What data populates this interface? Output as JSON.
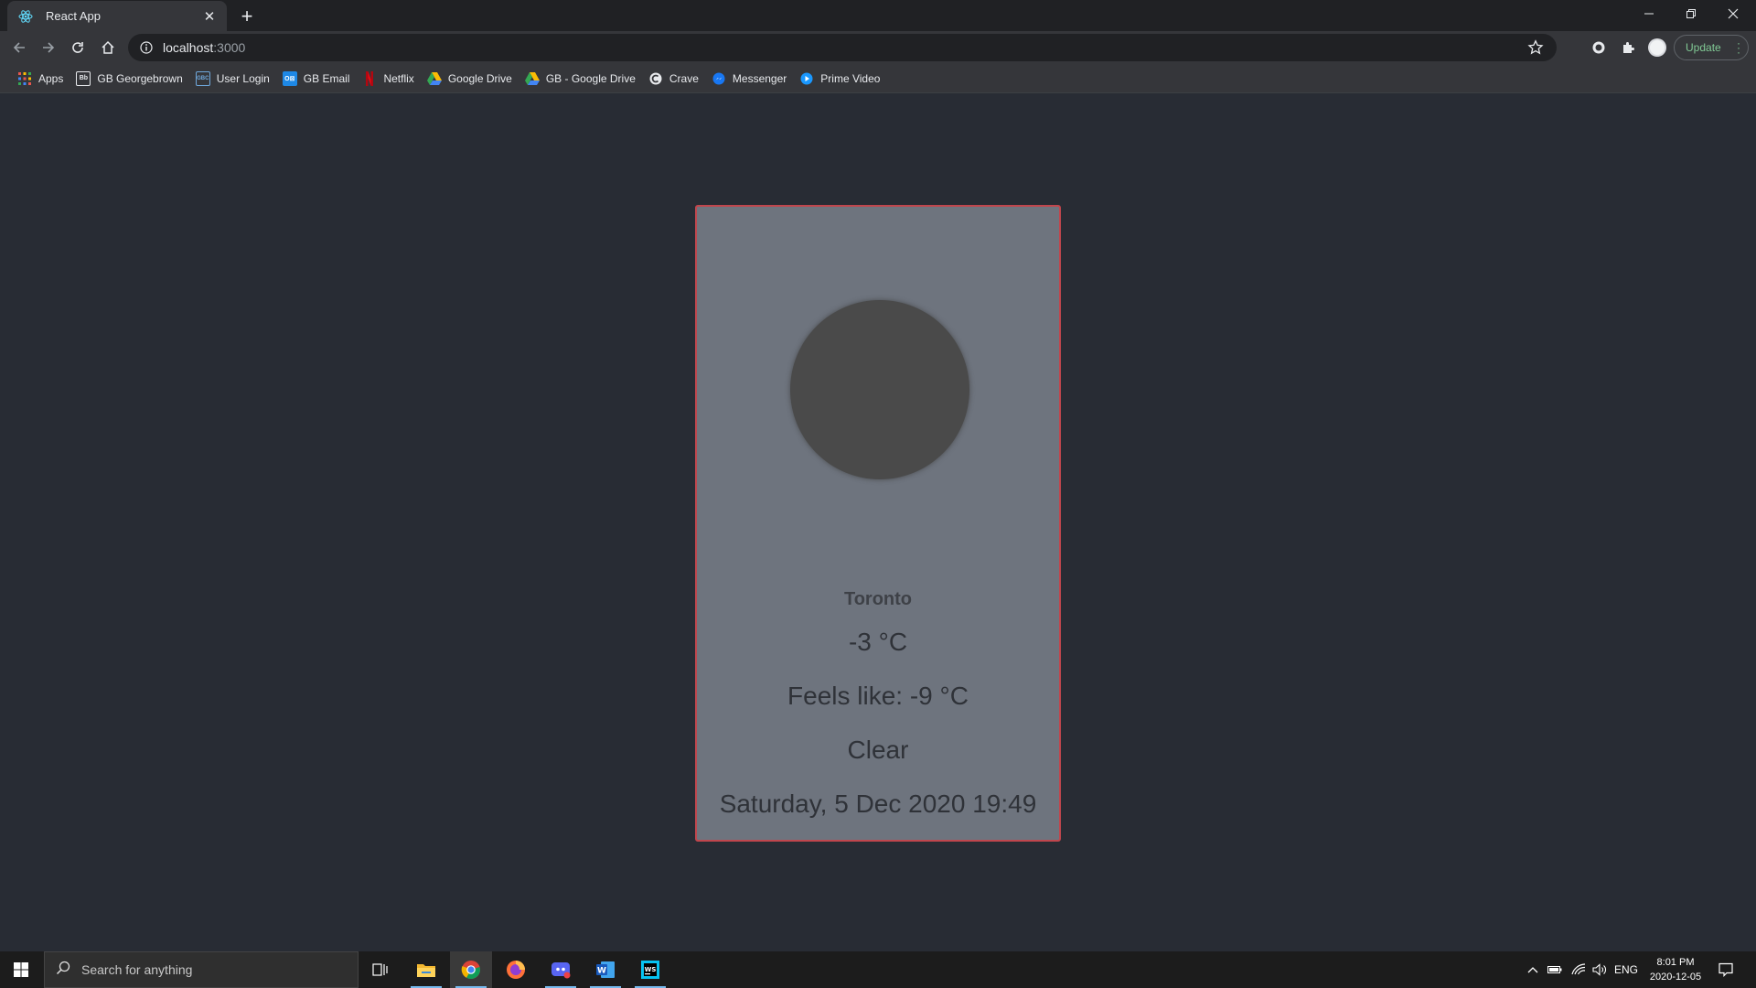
{
  "browser": {
    "tab_title": "React App",
    "url_host": "localhost",
    "url_port": ":3000",
    "update_label": "Update"
  },
  "bookmarks": [
    {
      "label": "Apps",
      "icon": "apps-grid-icon",
      "color": "#e8eaed"
    },
    {
      "label": "GB Georgebrown",
      "icon": "gb-bookmark-icon",
      "color": "#e8eaed"
    },
    {
      "label": "User Login",
      "icon": "gbc-bookmark-icon",
      "color": "#6fa8dc"
    },
    {
      "label": "GB Email",
      "icon": "outlook-icon",
      "color": "#1e88e5"
    },
    {
      "label": "Netflix",
      "icon": "netflix-icon",
      "color": "#e50914"
    },
    {
      "label": "Google Drive",
      "icon": "google-drive-icon",
      "color": "#fbbc04"
    },
    {
      "label": "GB - Google Drive",
      "icon": "google-drive-icon",
      "color": "#fbbc04"
    },
    {
      "label": "Crave",
      "icon": "crave-icon",
      "color": "#e8eaed"
    },
    {
      "label": "Messenger",
      "icon": "messenger-icon",
      "color": "#1877f2"
    },
    {
      "label": "Prime Video",
      "icon": "prime-video-icon",
      "color": "#1a98ff"
    }
  ],
  "weather": {
    "city": "Toronto",
    "temperature": "-3 °C",
    "feels_like": "Feels like: -9 °C",
    "condition": "Clear",
    "date": "Saturday, 5 Dec 2020 19:49"
  },
  "taskbar": {
    "search_placeholder": "Search for anything",
    "tray_language": "ENG",
    "time": "8:01 PM",
    "date": "2020-12-05"
  },
  "colors": {
    "page_bg": "#282c34",
    "card_bg": "#6e747e",
    "card_border": "#c0464d",
    "circle": "#4a4a4a"
  }
}
